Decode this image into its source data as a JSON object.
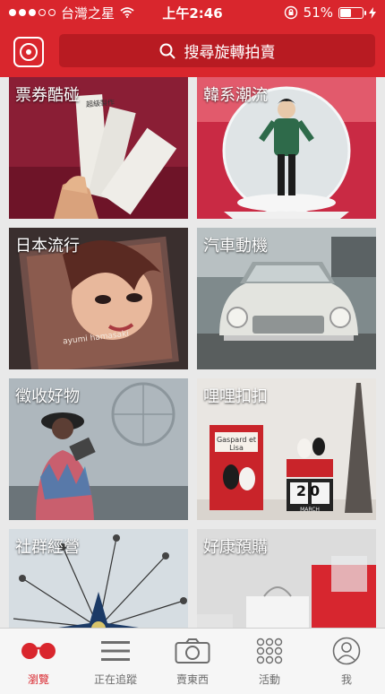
{
  "status_bar": {
    "carrier": "台灣之星",
    "time": "上午2:46",
    "battery_percent": "51%",
    "battery_level": 0.51,
    "signal_dots_filled": 3,
    "signal_dots_total": 5
  },
  "header": {
    "logo_icon": "rotating-auction-logo-icon",
    "search_placeholder": "搜尋旋轉拍賣"
  },
  "categories": [
    {
      "label": "票券酷碰"
    },
    {
      "label": "韓系潮流"
    },
    {
      "label": "日本流行"
    },
    {
      "label": "汽車動機"
    },
    {
      "label": "徵收好物"
    },
    {
      "label": "哩哩扣扣"
    },
    {
      "label": "社群經營"
    },
    {
      "label": "好康預購"
    }
  ],
  "tile_texts": {
    "ticket_text": "超級製作",
    "cd_artist": "ayumi hamasaki",
    "book_title": "Gaspard et Lisa",
    "calendar_day": "20",
    "calendar_month": "MARCH"
  },
  "tabbar": {
    "tabs": [
      {
        "label": "瀏覽",
        "icon": "browse-icon",
        "active": true
      },
      {
        "label": "正在追蹤",
        "icon": "list-icon",
        "active": false
      },
      {
        "label": "賣東西",
        "icon": "camera-icon",
        "active": false
      },
      {
        "label": "活動",
        "icon": "grid-dots-icon",
        "active": false
      },
      {
        "label": "我",
        "icon": "user-icon",
        "active": false
      }
    ]
  },
  "colors": {
    "brand_red": "#d9262d",
    "search_red": "#b81b22",
    "tab_inactive": "#6d6d6d"
  }
}
